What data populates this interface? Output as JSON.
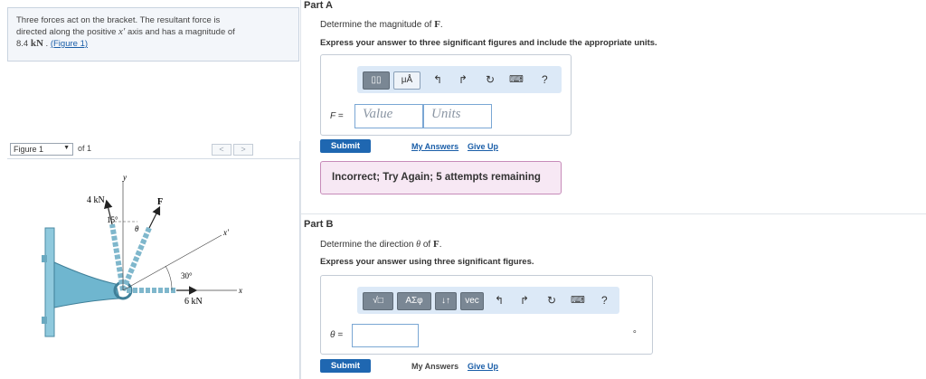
{
  "problem": {
    "text1": "Three forces act on the bracket. The resultant force is",
    "text2a": "directed along the positive ",
    "text2_var": "x′",
    "text2b": " axis and has a magnitude of",
    "text3_val": "8.4 ",
    "text3_unit": "kN",
    "text3_sep": " . ",
    "figure_link": "(Figure 1)"
  },
  "figure_nav": {
    "selected": "Figure 1",
    "of_label": "of 1",
    "prev": "<",
    "next": ">"
  },
  "figure": {
    "force_4kn": "4 kN",
    "force_6kn": "6 kN",
    "angle_15": "15°",
    "angle_30": "30°",
    "theta": "θ",
    "label_f": "F",
    "axis_y": "y",
    "axis_x": "x",
    "axis_xprime": "x′"
  },
  "part_a": {
    "label": "Part A",
    "prompt_text": "Determine the magnitude of ",
    "prompt_var": "F",
    "prompt_end": ".",
    "instruction": "Express your answer to three significant figures and include the appropriate units.",
    "toolbar": {
      "templates": "▯▯",
      "units": "μÅ",
      "help": "?"
    },
    "field_label": "F =",
    "value_placeholder": "Value",
    "units_placeholder": "Units",
    "submit": "Submit",
    "my_answers": "My Answers",
    "give_up": "Give Up",
    "feedback": "Incorrect; Try Again; 5 attempts remaining"
  },
  "part_b": {
    "label": "Part B",
    "prompt_text": "Determine the direction ",
    "prompt_var": "θ",
    "prompt_mid": " of ",
    "prompt_var2": "F",
    "prompt_end": ".",
    "instruction": "Express your answer using three significant figures.",
    "toolbar": {
      "radical": "√□",
      "greek": "ΑΣφ",
      "arrows": "↓↑",
      "vec": "vec",
      "help": "?"
    },
    "field_label": "θ =",
    "unit": "∘",
    "submit": "Submit",
    "my_answers": "My Answers",
    "give_up": "Give Up"
  },
  "colors": {
    "accent": "#1f67b1",
    "toolbar_bg": "#dce9f7",
    "feedback_bg": "#f7e8f4",
    "bracket": "#6fb6cf"
  }
}
